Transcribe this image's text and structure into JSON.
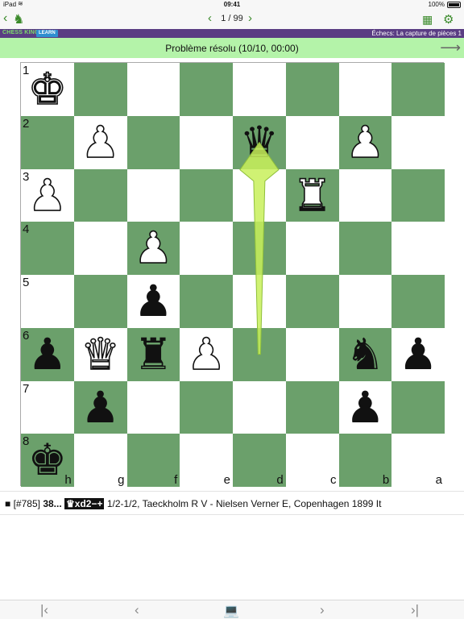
{
  "status_bar": {
    "carrier": "iPad",
    "time": "09:41",
    "battery": "100%"
  },
  "navigation": {
    "page_indicator": "1 / 99",
    "back_icon": "chevron-left-icon",
    "logo_icon": "knight-logo-icon",
    "grid_icon": "grid-icon",
    "settings_icon": "gear-icon"
  },
  "brand": {
    "name": "CHESS KING",
    "learn_badge": "LEARN",
    "course_title": "Échecs: La capture de pièces 1"
  },
  "problem": {
    "status": "Problème résolu (10/10, 00:00)",
    "next_icon": "right-arrow-icon"
  },
  "board": {
    "orientation": "black-bottom",
    "light_color": "#ffffff",
    "dark_color": "#6ba06b",
    "rank_labels": [
      "1",
      "2",
      "3",
      "4",
      "5",
      "6",
      "7",
      "8"
    ],
    "file_labels": [
      "h",
      "g",
      "f",
      "e",
      "d",
      "c",
      "b",
      "a"
    ],
    "pieces": [
      {
        "square": "h1",
        "type": "king",
        "color": "white"
      },
      {
        "square": "g2",
        "type": "pawn",
        "color": "white"
      },
      {
        "square": "d2",
        "type": "queen",
        "color": "black"
      },
      {
        "square": "b2",
        "type": "pawn",
        "color": "white"
      },
      {
        "square": "h3",
        "type": "pawn",
        "color": "white"
      },
      {
        "square": "c3",
        "type": "rook",
        "color": "white"
      },
      {
        "square": "f4",
        "type": "pawn",
        "color": "white"
      },
      {
        "square": "f5",
        "type": "pawn",
        "color": "black"
      },
      {
        "square": "h6",
        "type": "pawn",
        "color": "black"
      },
      {
        "square": "g6",
        "type": "queen",
        "color": "white"
      },
      {
        "square": "f6",
        "type": "rook",
        "color": "black"
      },
      {
        "square": "e6",
        "type": "pawn",
        "color": "white"
      },
      {
        "square": "b6",
        "type": "knight",
        "color": "black"
      },
      {
        "square": "a6",
        "type": "pawn",
        "color": "black"
      },
      {
        "square": "g7",
        "type": "pawn",
        "color": "black"
      },
      {
        "square": "b7",
        "type": "pawn",
        "color": "black"
      },
      {
        "square": "h8",
        "type": "king",
        "color": "black"
      }
    ],
    "last_move_arrow": {
      "from": "d6",
      "to": "d2",
      "color": "#c8f05a"
    }
  },
  "move": {
    "index": "[#785]",
    "number": "38...",
    "san": "♛xd2−+",
    "result": "1/2-1/2, Taeckholm R V - Nielsen Verner E, Copenhagen 1899 It"
  },
  "toolbar": {
    "first_icon": "first-move-icon",
    "prev_icon": "previous-move-icon",
    "board_icon": "laptop-icon",
    "next_icon": "next-move-icon",
    "last_icon": "last-move-icon"
  }
}
